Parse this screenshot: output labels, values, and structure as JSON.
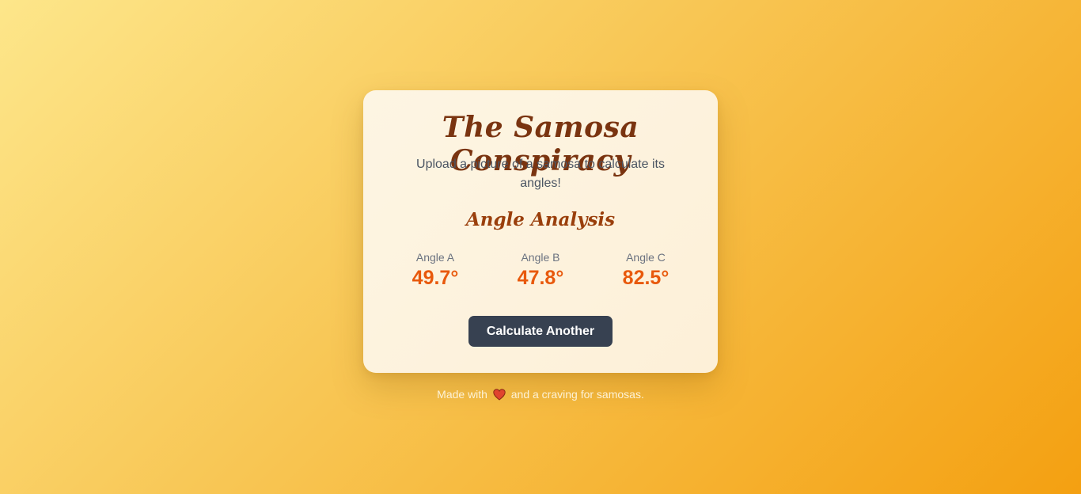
{
  "card": {
    "title": "The Samosa Conspiracy",
    "subtitle": "Upload a picture of a samosa to calculate its angles!",
    "section_title": "Angle Analysis",
    "angles": [
      {
        "label": "Angle A",
        "value": "49.7°"
      },
      {
        "label": "Angle B",
        "value": "47.8°"
      },
      {
        "label": "Angle C",
        "value": "82.5°"
      }
    ],
    "button_label": "Calculate Another"
  },
  "footer": {
    "prefix": "Made with",
    "icon": "heart-icon",
    "suffix": "and a craving for samosas."
  },
  "colors": {
    "background_start": "#fde68a",
    "background_end": "#f4a011",
    "title": "#7a3410",
    "angle_value": "#e8590c",
    "button": "#374151"
  }
}
